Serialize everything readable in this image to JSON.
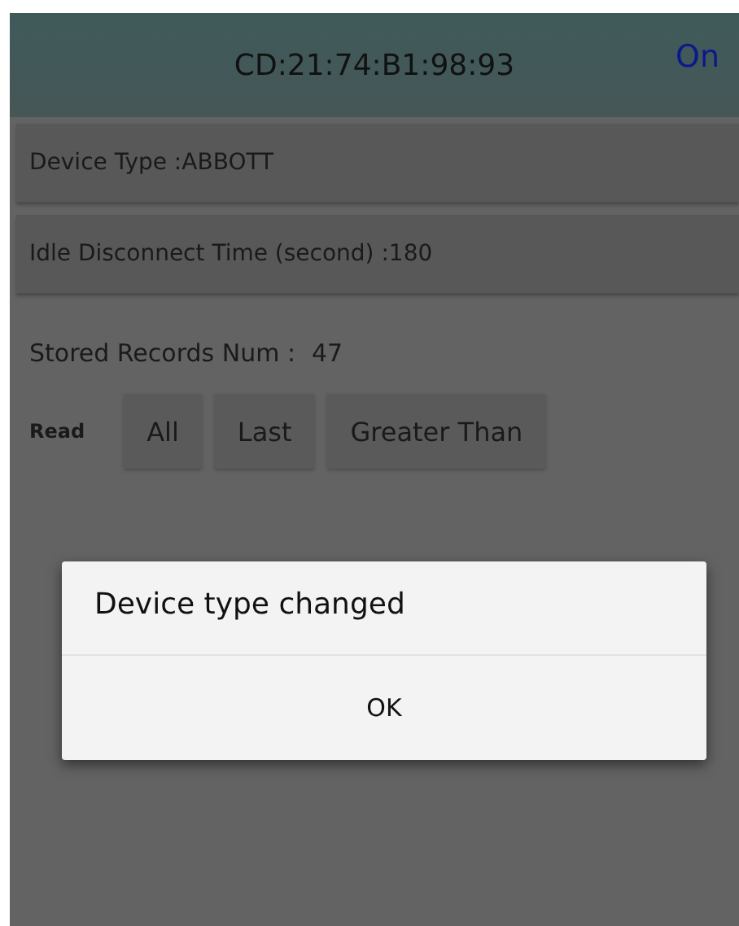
{
  "header": {
    "title": "CD:21:74:B1:98:93",
    "status": "On"
  },
  "fields": [
    {
      "text": "Device Type :ABBOTT"
    },
    {
      "text": "Idle Disconnect Time (second) :180"
    }
  ],
  "stored_records": {
    "label": "Stored Records Num :",
    "value": "47"
  },
  "read": {
    "label": "Read",
    "buttons": [
      "All",
      "Last",
      "Greater Than"
    ]
  },
  "dialog": {
    "message": "Device type changed",
    "button": "OK"
  }
}
